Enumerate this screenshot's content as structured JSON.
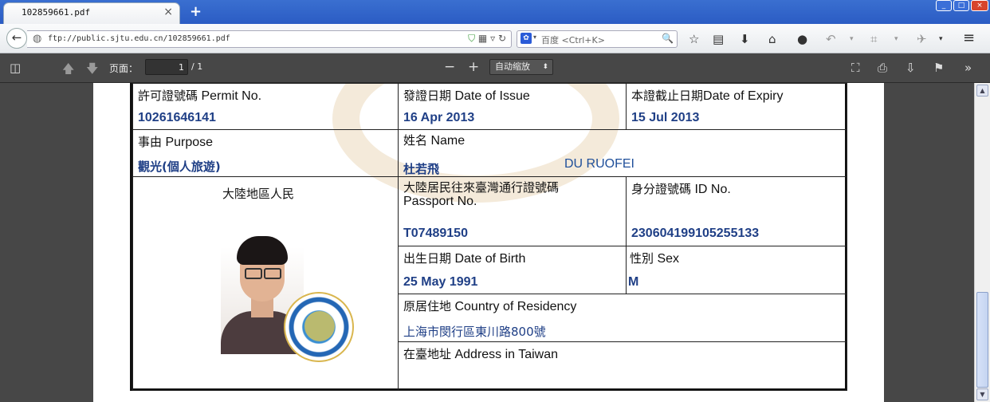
{
  "browser": {
    "tab_title": "102859661.pdf",
    "tab_close": "×",
    "new_tab": "+",
    "window_buttons": [
      "_",
      "□",
      "×"
    ],
    "url": "ftp://public.sjtu.edu.cn/102859661.pdf",
    "search_engine": "百度",
    "search_placeholder": "<Ctrl+K>"
  },
  "pdf_toolbar": {
    "page_label": "页面：",
    "page_current": "1",
    "page_total": "/ 1",
    "zoom_minus": "−",
    "zoom_plus": "+",
    "zoom_value": "自动缩放"
  },
  "permit": {
    "permit_no": {
      "label_zh": "許可證號碼",
      "label_en": "Permit No.",
      "value": "10261646141"
    },
    "issue_date": {
      "label_zh": "發證日期",
      "label_en": "Date of Issue",
      "value": "16 Apr 2013"
    },
    "expiry_date": {
      "label_zh": "本證截止日期",
      "label_en": "Date of Expiry",
      "value": "15 Jul 2013"
    },
    "purpose": {
      "label_zh": "事由",
      "label_en": "Purpose",
      "value": "觀光(個人旅遊)"
    },
    "name": {
      "label_zh": "姓名",
      "label_en": "Name",
      "value_zh": "杜若飛",
      "value_en": "DU RUOFEI"
    },
    "photo_caption": "大陸地區人民",
    "passport_no": {
      "label_zh": "大陸居民往來臺灣通行證號碼",
      "label_en": "Passport No.",
      "value": "T07489150"
    },
    "id_no": {
      "label_zh": "身分證號碼",
      "label_en": "ID No.",
      "value": "230604199105255133"
    },
    "birth_date": {
      "label_zh": "出生日期",
      "label_en": "Date of Birth",
      "value": "25 May 1991"
    },
    "sex": {
      "label_zh": "性別",
      "label_en": "Sex",
      "value": "M"
    },
    "residency": {
      "label_zh": "原居住地",
      "label_en": "Country of Residency",
      "value": "上海市閔行區東川路800號"
    },
    "address_taiwan": {
      "label_zh": "在臺地址",
      "label_en": "Address in Taiwan"
    }
  },
  "colors": {
    "value_blue": "#1f3f86",
    "titlebar_blue": "#2b5cc4",
    "pdf_toolbar": "#474747"
  }
}
